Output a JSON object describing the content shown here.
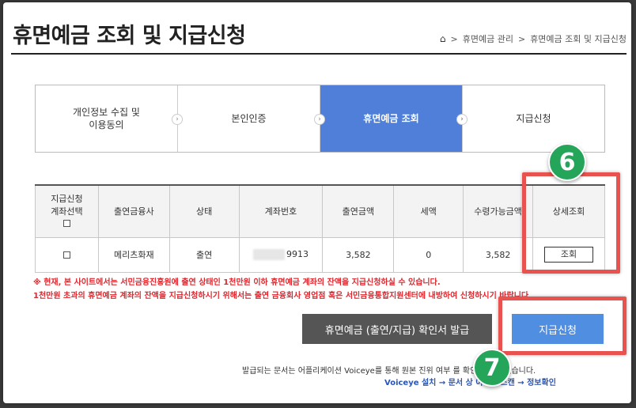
{
  "page": {
    "title": "휴면예금 조회 및 지급신청"
  },
  "breadcrumb": {
    "home_icon": "home-icon",
    "sep": ">",
    "level1": "휴면예금 관리",
    "level2": "휴면예금 조회 및 지급신청"
  },
  "steps": [
    {
      "line1": "개인정보 수집 및",
      "line2": "이용동의",
      "active": false
    },
    {
      "line1": "본인인증",
      "line2": "",
      "active": true
    },
    {
      "line1": "휴면예금 조회",
      "line2": "",
      "active": true
    },
    {
      "line1": "지급신청",
      "line2": "",
      "active": false
    }
  ],
  "table": {
    "headers": [
      "지급신청\n계좌선택",
      "출연금융사",
      "상태",
      "계좌번호",
      "출연금액",
      "세액",
      "수령가능금액",
      "상세조회"
    ],
    "header0_line1": "지급신청",
    "header0_line2": "계좌선택",
    "rows": [
      {
        "institution": "메리츠화재",
        "status": "출연",
        "account_suffix": "9913",
        "amount": "3,582",
        "tax": "0",
        "receivable": "3,582",
        "detail_label": "조회"
      }
    ]
  },
  "notice": {
    "line1": "※ 현재, 본 사이트에서는 서민금융진흥원에 출연 상태인 1천만원 이하 휴면예금 계좌의 잔액을 지급신청하실 수 있습니다.",
    "line2": "1천만원 초과의 휴면예금 계좌의 잔액을 지급신청하시기 위해서는 출연 금융회사 영업점 혹은 서민금융통합지원센터에 내방하여 신청하시기 바랍니다."
  },
  "buttons": {
    "certificate": "휴면예금 (출연/지급) 확인서 발급",
    "apply": "지급신청"
  },
  "info": {
    "line1": "발급되는 문서는 어플리케이션 Voiceye를 통해 원본 진위 여부 를 확인하실 수 있습니다.",
    "line2": "Voiceye 설치 → 문서 상 이미지 스캔 → 정보확인"
  },
  "annotations": {
    "badge6": "6",
    "badge7": "7"
  },
  "colors": {
    "active_step": "#4f7fd8",
    "highlight": "#e9534f",
    "badge": "#25a55a",
    "apply": "#4f8ee0"
  }
}
